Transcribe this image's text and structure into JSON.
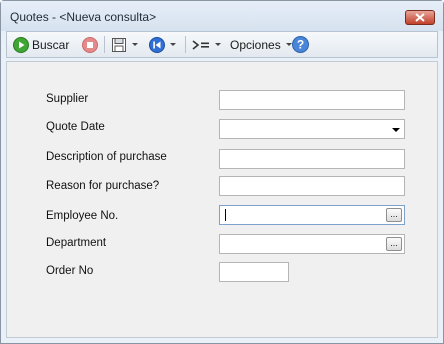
{
  "window": {
    "title": "Quotes - <Nueva consulta>"
  },
  "toolbar": {
    "search_label": "Buscar",
    "options_label": "Opciones",
    "icons": [
      "play-icon",
      "stop-icon",
      "save-icon",
      "back-icon",
      "filter-icon",
      "help-icon"
    ],
    "help_glyph": "?"
  },
  "form": {
    "supplier_label": "Supplier",
    "quote_date_label": "Quote Date",
    "description_label": "Description of purchase",
    "reason_label": "Reason for purchase?",
    "employee_label": "Employee No.",
    "department_label": "Department",
    "order_no_label": "Order No",
    "lookup_button": "..."
  },
  "colors": {
    "play_green": "#3fa535",
    "stop_red": "#e58a8a",
    "back_blue": "#2f6fd6",
    "help_blue": "#4a86d8",
    "close_red": "#c2402a"
  }
}
